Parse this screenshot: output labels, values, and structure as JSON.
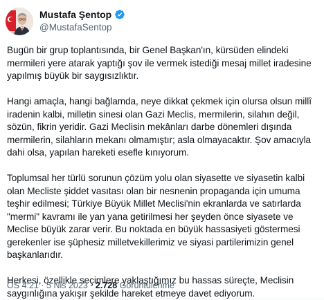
{
  "author": {
    "display_name": "Mustafa Şentop",
    "handle": "@MustafaSentop",
    "verified": true,
    "avatar_icon": "profile-photo-with-flag"
  },
  "tweet": {
    "paragraphs": [
      "Bugün bir grup toplantısında, bir Genel Başkan'ın, kürsüden elindeki mermileri yere atarak yaptığı şov ile vermek istediği mesaj millet iradesine yapılmış büyük bir saygısızlıktır.",
      "Hangi amaçla, hangi bağlamda, neye dikkat çekmek için olursa olsun millî iradenin kalbi, milletin sinesi olan Gazi Meclis, mermilerin, silahın değil, sözün, fikrin yeridir. Gazi Meclisin mekânları darbe dönemleri dışında mermilerin, silahların mekanı olmamıştır; asla olmayacaktır. Şov amacıyla dahi olsa, yapılan hareketi esefle kınıyorum.",
      "Toplumsal her türlü sorunun çözüm yolu olan siyasette ve siyasetin kalbi olan Mecliste şiddet vasıtası olan bir nesnenin propaganda için umuma teşhir edilmesi; Türkiye Büyük Millet Meclisi'nin ekranlarda ve satırlarda \"mermi\" kavramı ile yan yana getirilmesi her şeyden önce siyasete ve Meclise büyük zarar verir. Bu noktada en büyük hassasiyeti göstermesi gerekenler ise şüphesiz milletvekillerimiz ve siyasi partilerimizin genel başkanlarıdır.",
      "Herkesi, özellikle seçimlere yaklaştığımız bu hassas süreçte, Meclisin saygınlığına yakışır şekilde hareket etmeye davet ediyorum."
    ]
  },
  "meta": {
    "time": "ÖS 4:21",
    "separator": "·",
    "date": "5 Nis 2023",
    "views_count": "2.728",
    "views_label": "Görüntülenme"
  },
  "colors": {
    "text": "#0f1419",
    "secondary": "#536471",
    "verified": "#1d9bf0"
  }
}
